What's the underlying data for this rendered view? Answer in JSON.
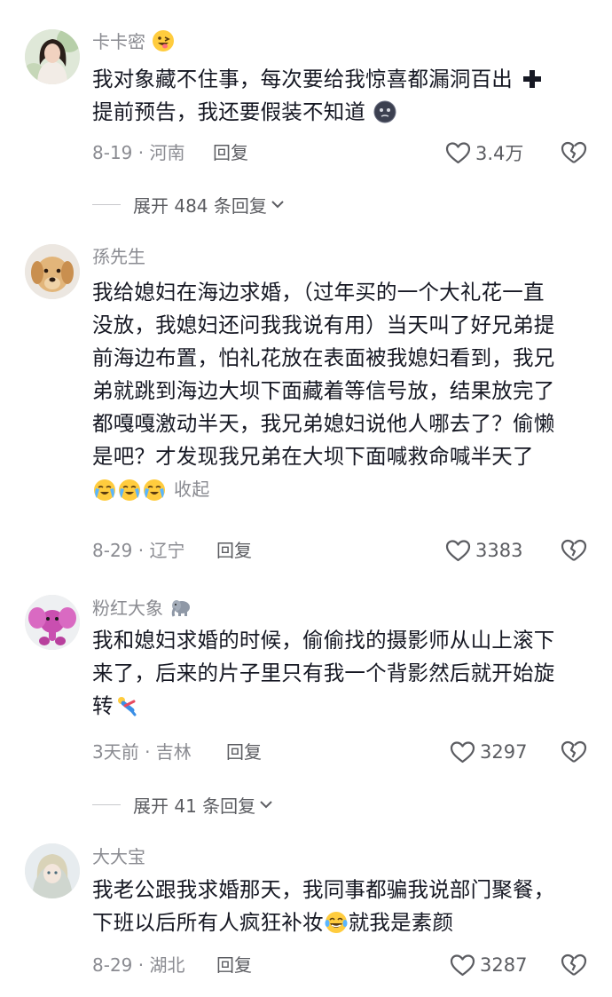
{
  "comments": [
    {
      "username": "卡卡密",
      "lines": [
        "我对象藏不住事，每次要给我惊喜都漏洞百出 ",
        "提前预告，我还要假装不知道"
      ],
      "date_loc": "8-19 · 河南",
      "reply": "回复",
      "likes": "3.4万"
    },
    {
      "username": "孫先生",
      "lines": [
        "我给媳妇在海边求婚，（过年买的一个大礼花一直",
        "没放，我媳妇还问我我说有用）当天叫了好兄弟提",
        "前海边布置，怕礼花放在表面被我媳妇看到，我兄",
        "弟就跳到海边大坝下面藏着等信号放，结果放完了",
        "都嘎嘎激动半天，我兄弟媳妇说他人哪去了？偷懒",
        "是吧？才发现我兄弟在大坝下面喊救命喊半天了"
      ],
      "collapse": "收起",
      "date_loc": "8-29 · 辽宁",
      "reply": "回复",
      "likes": "3383"
    },
    {
      "username": "粉红大象",
      "lines": [
        "我和媳妇求婚的时候，偷偷找的摄影师从山上滚下",
        "来了，后来的片子里只有我一个背影然后就开始旋",
        "转"
      ],
      "date_loc": "3天前 · 吉林",
      "reply": "回复",
      "likes": "3297"
    },
    {
      "username": "大大宝",
      "lines": [
        "我老公跟我求婚那天，我同事都骗我说部门聚餐，",
        "下班以后所有人疯狂补妆",
        "就我是素颜"
      ],
      "date_loc": "8-29 · 湖北",
      "reply": "回复",
      "likes": "3287"
    }
  ],
  "expand_1": "展开 484 条回复",
  "expand_2": "展开 41 条回复",
  "icons": {
    "like": "heart-outline-icon",
    "dislike": "broken-heart-icon",
    "expand": "chevron-down-icon"
  },
  "colors": {
    "text": "#161823",
    "secondary": "#8a8b91",
    "action": "#5b5c61"
  }
}
